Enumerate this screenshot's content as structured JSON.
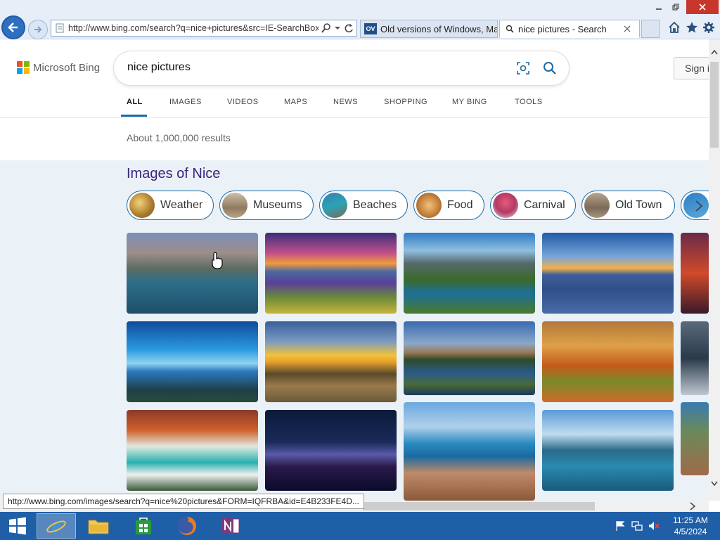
{
  "browser": {
    "address_url": "http://www.bing.com/search?q=nice+pictures&src=IE-SearchBox&",
    "tabs": [
      {
        "label": "Old versions of Windows, Mac ...",
        "favicon": "OV"
      },
      {
        "label": "nice pictures - Search"
      }
    ]
  },
  "bing": {
    "logo_text": "Microsoft Bing",
    "query": "nice pictures",
    "sign_in_label": "Sign i",
    "scopes": [
      "ALL",
      "IMAGES",
      "VIDEOS",
      "MAPS",
      "NEWS",
      "SHOPPING",
      "MY BING",
      "TOOLS"
    ],
    "active_scope": "ALL",
    "results_count": "About 1,000,000 results"
  },
  "images_section": {
    "title": "Images of Nice",
    "chips": [
      "Weather",
      "Museums",
      "Beaches",
      "Food",
      "Carnival",
      "Old Town"
    ]
  },
  "status_bar": {
    "url": "http://www.bing.com/images/search?q=nice%20pictures&FORM=IQFRBA&id=E4B233FE4D..."
  },
  "taskbar": {
    "time": "11:25 AM",
    "date": "4/5/2024"
  },
  "colors": {
    "accent": "#1a6aa6",
    "title_purple": "#3c237a",
    "taskbar": "#1f5fa8"
  }
}
